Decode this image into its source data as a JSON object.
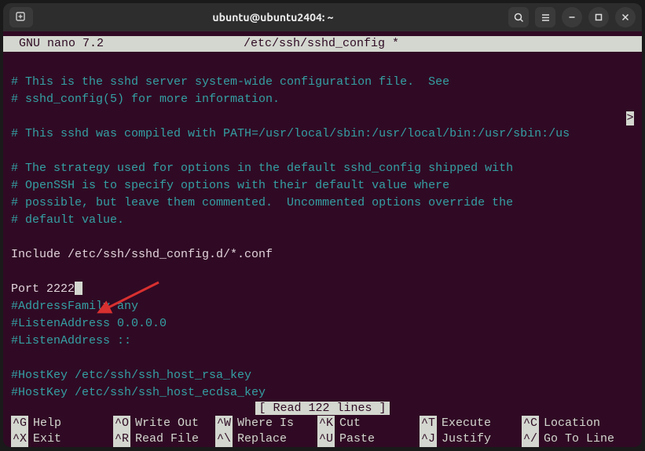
{
  "window": {
    "title": "ubuntu@ubuntu2404: ~"
  },
  "nano": {
    "version_label": "GNU nano 7.2",
    "file_label": "/etc/ssh/sshd_config *",
    "status": "[ Read 122 lines ]",
    "truncation_marker": ">"
  },
  "editor": {
    "lines": [
      {
        "text": "",
        "cls": ""
      },
      {
        "text": "# This is the sshd server system-wide configuration file.  See",
        "cls": "comment"
      },
      {
        "text": "# sshd_config(5) for more information.",
        "cls": "comment"
      },
      {
        "text": "",
        "cls": ""
      },
      {
        "text": "# This sshd was compiled with PATH=/usr/local/sbin:/usr/local/bin:/usr/sbin:/us",
        "cls": "comment"
      },
      {
        "text": "",
        "cls": ""
      },
      {
        "text": "# The strategy used for options in the default sshd_config shipped with",
        "cls": "comment"
      },
      {
        "text": "# OpenSSH is to specify options with their default value where",
        "cls": "comment"
      },
      {
        "text": "# possible, but leave them commented.  Uncommented options override the",
        "cls": "comment"
      },
      {
        "text": "# default value.",
        "cls": "comment"
      },
      {
        "text": "",
        "cls": ""
      },
      {
        "text": "Include /etc/ssh/sshd_config.d/*.conf",
        "cls": "uncommented"
      },
      {
        "text": "",
        "cls": ""
      },
      {
        "text": "Port 2222",
        "cls": "uncommented",
        "cursor": true
      },
      {
        "text": "#AddressFamily any",
        "cls": "comment"
      },
      {
        "text": "#ListenAddress 0.0.0.0",
        "cls": "comment"
      },
      {
        "text": "#ListenAddress ::",
        "cls": "comment"
      },
      {
        "text": "",
        "cls": ""
      },
      {
        "text": "#HostKey /etc/ssh/ssh_host_rsa_key",
        "cls": "comment"
      },
      {
        "text": "#HostKey /etc/ssh/ssh_host_ecdsa_key",
        "cls": "comment"
      }
    ]
  },
  "shortcuts": {
    "row1": [
      {
        "key": "^G",
        "label": "Help"
      },
      {
        "key": "^O",
        "label": "Write Out"
      },
      {
        "key": "^W",
        "label": "Where Is"
      },
      {
        "key": "^K",
        "label": "Cut"
      },
      {
        "key": "^T",
        "label": "Execute"
      },
      {
        "key": "^C",
        "label": "Location"
      }
    ],
    "row2": [
      {
        "key": "^X",
        "label": "Exit"
      },
      {
        "key": "^R",
        "label": "Read File"
      },
      {
        "key": "^\\",
        "label": "Replace"
      },
      {
        "key": "^U",
        "label": "Paste"
      },
      {
        "key": "^J",
        "label": "Justify"
      },
      {
        "key": "^/",
        "label": "Go To Line"
      }
    ]
  }
}
